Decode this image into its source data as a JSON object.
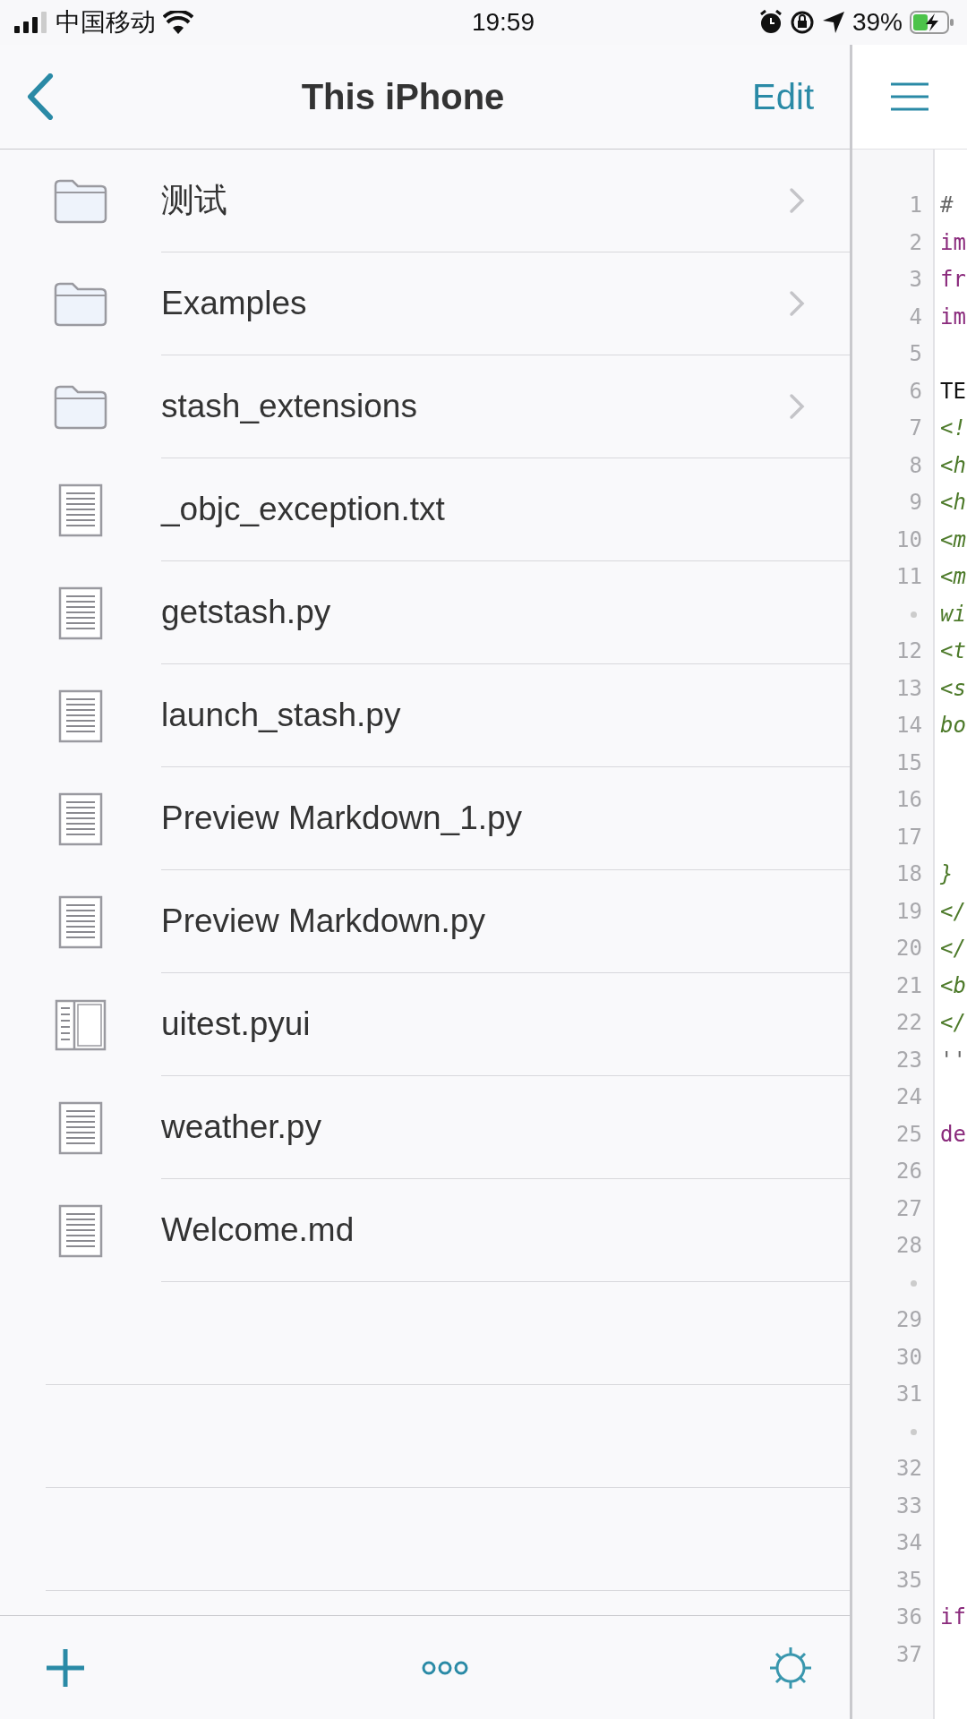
{
  "status_bar": {
    "carrier": "中国移动",
    "time": "19:59",
    "battery": "39%"
  },
  "nav": {
    "title": "This iPhone",
    "edit": "Edit"
  },
  "files": [
    {
      "kind": "folder",
      "name": "测试"
    },
    {
      "kind": "folder",
      "name": "Examples"
    },
    {
      "kind": "folder",
      "name": "stash_extensions"
    },
    {
      "kind": "file",
      "name": "_objc_exception.txt"
    },
    {
      "kind": "file",
      "name": "getstash.py"
    },
    {
      "kind": "file",
      "name": "launch_stash.py"
    },
    {
      "kind": "file",
      "name": "Preview Markdown_1.py"
    },
    {
      "kind": "file",
      "name": "Preview Markdown.py"
    },
    {
      "kind": "pyui",
      "name": "uitest.pyui"
    },
    {
      "kind": "file",
      "name": "weather.py"
    },
    {
      "kind": "file",
      "name": "Welcome.md"
    }
  ],
  "editor": {
    "lines": [
      {
        "number": "1",
        "text": "#",
        "kind": "comment"
      },
      {
        "number": "2",
        "text": "im",
        "kind": "keyword"
      },
      {
        "number": "3",
        "text": "fr",
        "kind": "keyword"
      },
      {
        "number": "4",
        "text": "im",
        "kind": "keyword"
      },
      {
        "number": "5"
      },
      {
        "number": "6",
        "text": "TE",
        "kind": "plain"
      },
      {
        "number": "7",
        "text": "<!",
        "kind": "string"
      },
      {
        "number": "8",
        "text": "<h",
        "kind": "string"
      },
      {
        "number": "9",
        "text": "<h",
        "kind": "string"
      },
      {
        "number": "10",
        "text": "<m",
        "kind": "string"
      },
      {
        "number": "11",
        "text": "<m",
        "kind": "string"
      },
      {
        "wrapped": true,
        "text": "wi",
        "kind": "string"
      },
      {
        "number": "12",
        "text": "<t",
        "kind": "string"
      },
      {
        "number": "13",
        "text": "<s",
        "kind": "string"
      },
      {
        "number": "14",
        "text": "bo",
        "kind": "string"
      },
      {
        "number": "15"
      },
      {
        "number": "16"
      },
      {
        "number": "17"
      },
      {
        "number": "18",
        "text": "}",
        "kind": "string"
      },
      {
        "number": "19",
        "text": "</",
        "kind": "string"
      },
      {
        "number": "20",
        "text": "</",
        "kind": "string"
      },
      {
        "number": "21",
        "text": "<b",
        "kind": "string"
      },
      {
        "number": "22",
        "text": "</",
        "kind": "string"
      },
      {
        "number": "23",
        "text": "''",
        "kind": "comment"
      },
      {
        "number": "24"
      },
      {
        "number": "25",
        "text": "de",
        "kind": "keyword"
      },
      {
        "number": "26"
      },
      {
        "number": "27"
      },
      {
        "number": "28"
      },
      {
        "wrapped": true
      },
      {
        "number": "29"
      },
      {
        "number": "30"
      },
      {
        "number": "31"
      },
      {
        "wrapped": true
      },
      {
        "number": "32"
      },
      {
        "number": "33"
      },
      {
        "number": "34"
      },
      {
        "number": "35"
      },
      {
        "number": "36",
        "text": "if",
        "kind": "keyword"
      },
      {
        "number": "37"
      }
    ]
  }
}
